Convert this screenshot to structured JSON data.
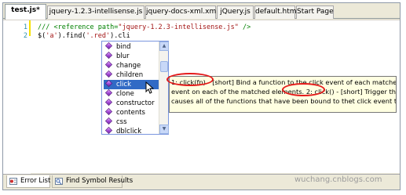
{
  "tabs": [
    {
      "label": "test.js*",
      "active": true
    },
    {
      "label": "jquery-1.2.3-intellisense.js",
      "active": false
    },
    {
      "label": "jquery-docs-xml.xml",
      "active": false
    },
    {
      "label": "jQuery.js",
      "active": false
    },
    {
      "label": "default.htm",
      "active": false
    },
    {
      "label": "Start Page",
      "active": false
    }
  ],
  "editor": {
    "line_numbers": [
      "1",
      "2"
    ],
    "line1": {
      "comment_prefix": "/// ",
      "tag_open": "<reference path=",
      "path": "\"jquery-1.2.3-intellisense.js\"",
      "tag_close": " />"
    },
    "line2": {
      "p1": "$(",
      "s1": "'a'",
      "p2": ").find(",
      "s2": "'.red'",
      "p3": ").cli"
    }
  },
  "intellisense": {
    "items": [
      "bind",
      "blur",
      "change",
      "children",
      "click",
      "clone",
      "constructor",
      "contents",
      "css",
      "dblclick"
    ],
    "selected": "click"
  },
  "tooltip": {
    "overload1_label": "1: click(fn) -",
    "overload1_text": "[short] Bind a function to the click event of each matched element.",
    "line2_text": "event on each of the matched elements.",
    "overload2_label": "2: click() -",
    "overload2_text": "[short] Trigger the click event",
    "line3_text": "causes all of the functions that have been bound to thet click event to be execut"
  },
  "bottom_tabs": [
    {
      "label": "Error List",
      "icon": "error-list-icon"
    },
    {
      "label": "Find Symbol Results",
      "icon": "find-symbol-icon"
    }
  ],
  "watermark": "wuchang.cnblogs.com",
  "colors": {
    "selection": "#316ac5",
    "annotation_ring": "#e51a1a",
    "tooltip_bg": "#ffffe1"
  }
}
